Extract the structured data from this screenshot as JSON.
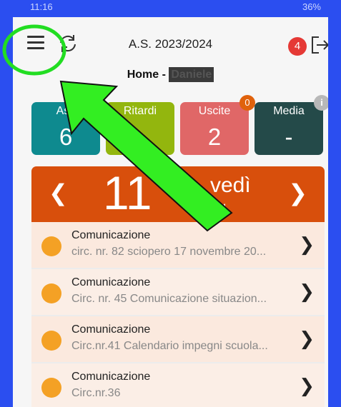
{
  "statusbar": {
    "time": "11:16",
    "right": "36%"
  },
  "header": {
    "year": "A.S. 2023/2024",
    "notifications": "4"
  },
  "home": {
    "title": "Home - ",
    "name": "Daniele"
  },
  "tiles": [
    {
      "label": "Ass",
      "value": "6",
      "color": "#0e8a8f"
    },
    {
      "label": "Ritardi",
      "value": "",
      "color": "#93b60e"
    },
    {
      "label": "Uscite",
      "value": "2",
      "color": "#e06767",
      "badge": "0"
    },
    {
      "label": "Media",
      "value": "-",
      "color": "#244a49"
    }
  ],
  "date": {
    "day": "11",
    "weekday": "vedì",
    "monthyear": "G 2024",
    "prev": "❮",
    "next": "❯"
  },
  "list": [
    {
      "title": "Comunicazione",
      "subtitle": "circ. nr. 82 sciopero 17 novembre 20..."
    },
    {
      "title": "Comunicazione",
      "subtitle": "Circ. nr. 45 Comunicazione situazion..."
    },
    {
      "title": "Comunicazione",
      "subtitle": "Circ.nr.41 Calendario impegni scuola..."
    },
    {
      "title": "Comunicazione",
      "subtitle": "Circ.nr.36"
    }
  ],
  "colors": {
    "accent_circle": "#22dd22",
    "arrow_fill": "#33ee22",
    "banner": "#d84f0c",
    "background": "#2b4ef0"
  }
}
